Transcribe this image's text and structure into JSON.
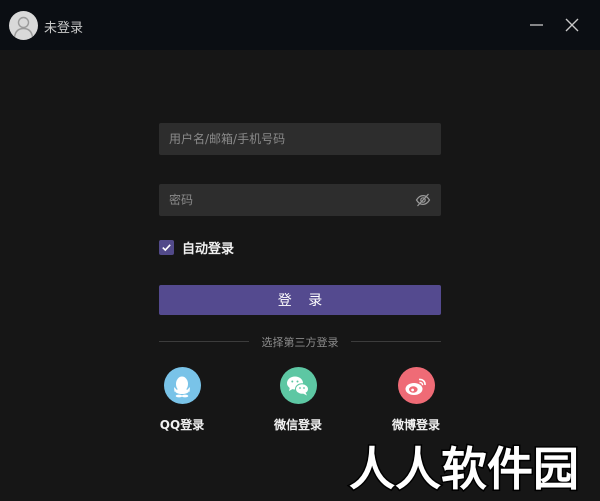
{
  "titlebar": {
    "user_status": "未登录",
    "icons": [
      "avatar-icon",
      "minimize-icon",
      "close-icon"
    ]
  },
  "form": {
    "username": {
      "placeholder": "用户名/邮箱/手机号码",
      "value": ""
    },
    "password": {
      "placeholder": "密码",
      "value": "",
      "visibility_icon": "eye-slash-icon"
    },
    "remember_me": {
      "label": "自动登录",
      "checked": true
    },
    "login_button": "登 录"
  },
  "third_party": {
    "divider_text": "选择第三方登录",
    "providers": [
      {
        "label": "QQ登录",
        "icon": "qq-icon",
        "color": "#79c3e8"
      },
      {
        "label": "微信登录",
        "icon": "wechat-icon",
        "color": "#5dc7a3"
      },
      {
        "label": "微博登录",
        "icon": "weibo-icon",
        "color": "#ef6b76"
      }
    ]
  },
  "watermark": {
    "text": "人人软件园"
  },
  "colors": {
    "background": "#161616",
    "titlebar": "#0b0e13",
    "accent": "#544a8f",
    "input": "#2d2d2d"
  }
}
